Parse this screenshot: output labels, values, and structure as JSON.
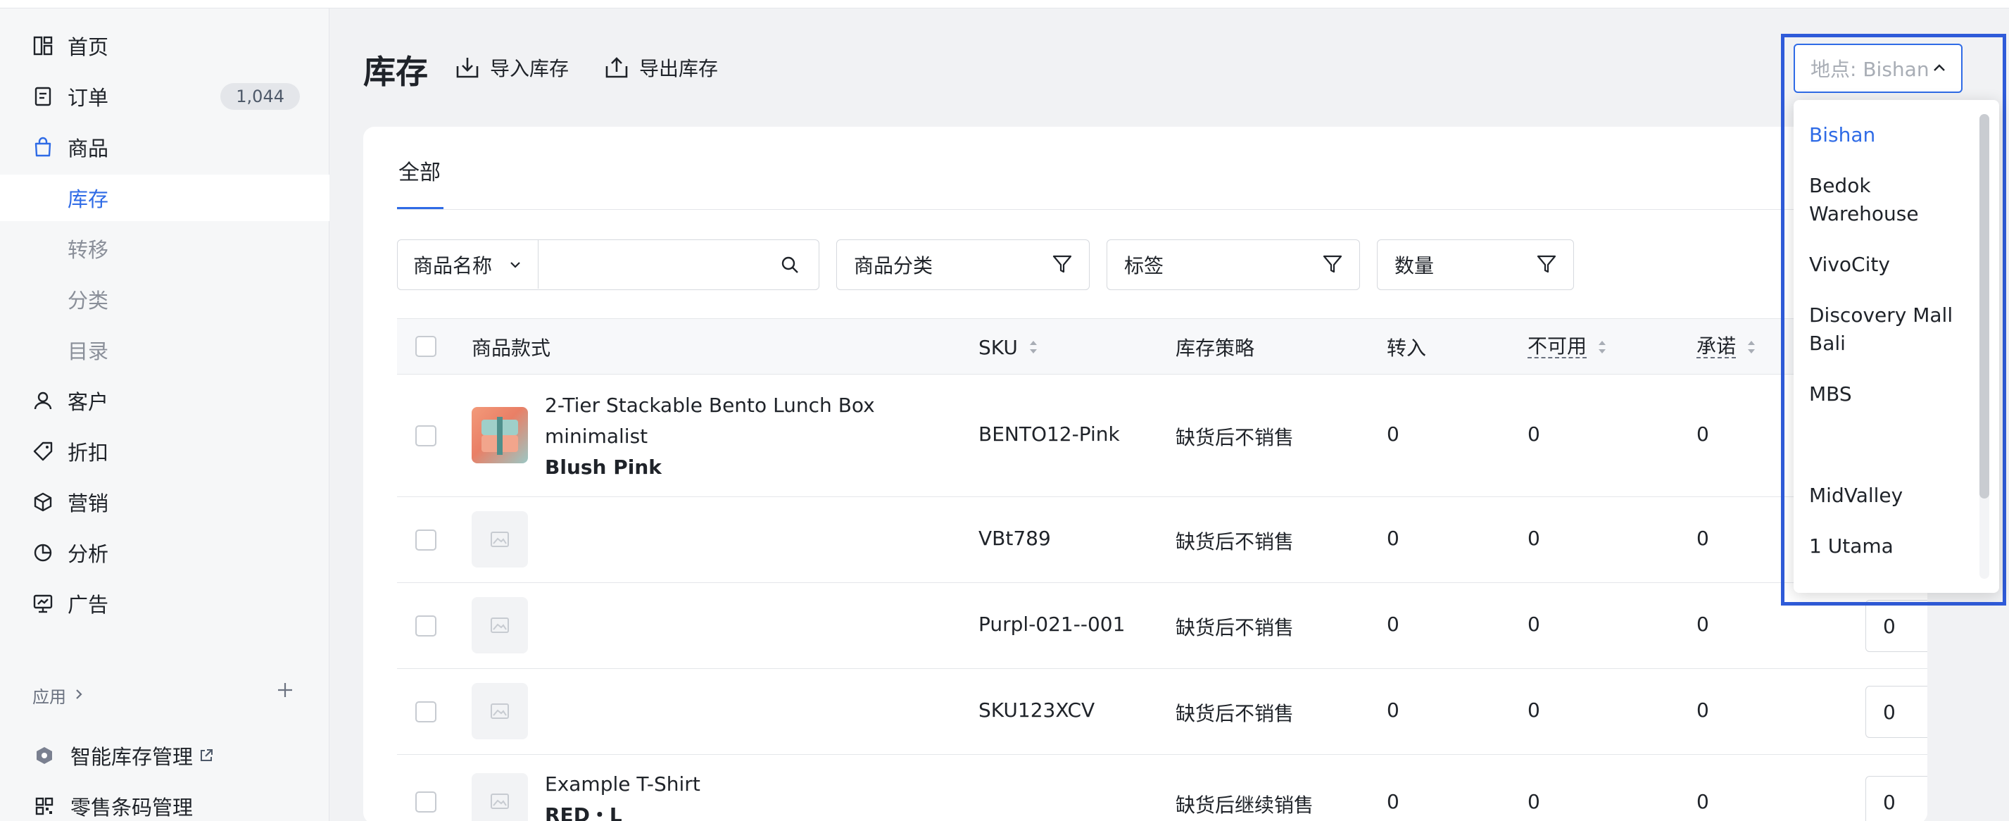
{
  "sidebar": {
    "items": [
      {
        "label": "首页",
        "icon": "home-icon"
      },
      {
        "label": "订单",
        "icon": "order-icon",
        "badge": "1,044"
      },
      {
        "label": "商品",
        "icon": "bag-icon"
      },
      {
        "label": "库存",
        "sub": true,
        "active": true
      },
      {
        "label": "转移",
        "sub": true
      },
      {
        "label": "分类",
        "sub": true
      },
      {
        "label": "目录",
        "sub": true
      },
      {
        "label": "客户",
        "icon": "person-icon"
      },
      {
        "label": "折扣",
        "icon": "tag-icon"
      },
      {
        "label": "营销",
        "icon": "cube-icon"
      },
      {
        "label": "分析",
        "icon": "pie-icon"
      },
      {
        "label": "广告",
        "icon": "ad-icon"
      }
    ],
    "apps_label": "应用",
    "apps": [
      {
        "label": "智能库存管理",
        "icon": "hexagon-icon"
      },
      {
        "label": "零售条码管理",
        "icon": "grid-icon"
      }
    ]
  },
  "header": {
    "title": "库存",
    "import_label": "导入库存",
    "export_label": "导出库存"
  },
  "tabs": {
    "all": "全部"
  },
  "filters": {
    "name_select": "商品名称",
    "search_value": "",
    "category": "商品分类",
    "tags": "标签",
    "quantity": "数量"
  },
  "table": {
    "columns": {
      "variant": "商品款式",
      "sku": "SKU",
      "policy": "库存策略",
      "incoming": "转入",
      "unavailable": "不可用",
      "committed": "承诺"
    },
    "rows": [
      {
        "name": "2-Tier Stackable Bento Lunch Box",
        "name2": "minimalist",
        "variant": "Blush Pink",
        "sku": "BENTO12-Pink",
        "policy": "缺货后不销售",
        "incoming": "0",
        "unavailable": "0",
        "committed": "0",
        "qty": ""
      },
      {
        "name": "",
        "name2": "",
        "variant": "",
        "sku": "VBt789",
        "policy": "缺货后不销售",
        "incoming": "0",
        "unavailable": "0",
        "committed": "0",
        "qty": ""
      },
      {
        "name": "",
        "name2": "",
        "variant": "",
        "sku": "Purpl-021--001",
        "policy": "缺货后不销售",
        "incoming": "0",
        "unavailable": "0",
        "committed": "0",
        "qty": "0"
      },
      {
        "name": "",
        "name2": "",
        "variant": "",
        "sku": "SKU123XCV",
        "policy": "缺货后不销售",
        "incoming": "0",
        "unavailable": "0",
        "committed": "0",
        "qty": "0"
      },
      {
        "name": "Example T-Shirt",
        "name2": "",
        "variant": "RED・L",
        "sku": "",
        "policy": "缺货后继续销售",
        "incoming": "0",
        "unavailable": "0",
        "committed": "0",
        "qty": "0"
      }
    ]
  },
  "location": {
    "select_label": "地点: Bishan",
    "options": [
      "Bishan",
      "Bedok Warehouse",
      "VivoCity",
      "Discovery Mall Bali",
      "MBS",
      "",
      "MidValley",
      "1 Utama"
    ]
  },
  "colors": {
    "accent": "#2f6be6",
    "highlight": "#2f5bd9"
  }
}
